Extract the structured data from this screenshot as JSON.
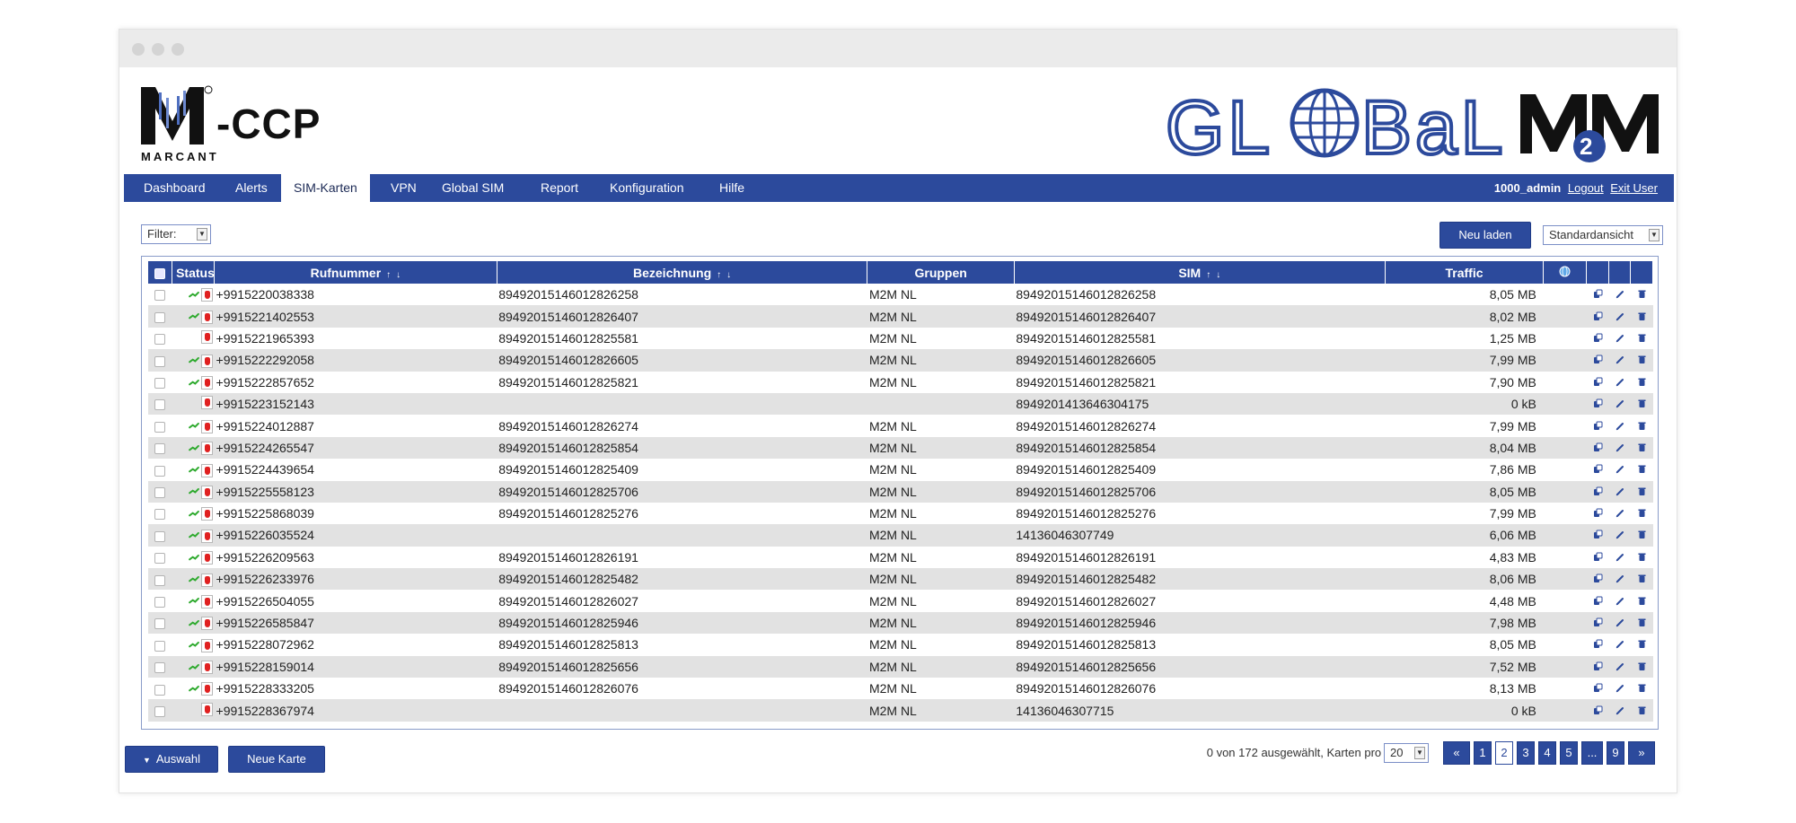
{
  "brand": {
    "left_logo_mark": "M",
    "left_logo_suffix": "-CCP",
    "left_logo_sub": "MARCANT",
    "right_logo_text": "GLOBAL",
    "right_logo_m2m": "M",
    "right_logo_two": "2",
    "accent_color": "#2c4a9c"
  },
  "nav": {
    "items": [
      {
        "label": "Dashboard"
      },
      {
        "label": "Alerts"
      },
      {
        "label": "SIM-Karten",
        "active": true
      },
      {
        "label": "VPN"
      },
      {
        "label": "Global SIM"
      },
      {
        "label": "Report"
      },
      {
        "label": "Konfiguration"
      },
      {
        "label": "Hilfe"
      }
    ],
    "user": "1000_admin",
    "logout": "Logout",
    "exit": "Exit User"
  },
  "toolbar": {
    "filter_label": "Filter:",
    "reload_label": "Neu laden",
    "view_select": "Standardansicht"
  },
  "table": {
    "headers": {
      "status": "Status",
      "rufnummer": "Rufnummer",
      "bezeichnung": "Bezeichnung",
      "gruppen": "Gruppen",
      "sim": "SIM",
      "traffic": "Traffic",
      "sort_up": "↑",
      "sort_down": "↓"
    },
    "rows": [
      {
        "active": true,
        "rufnummer": "+9915220038338",
        "bezeichnung": "89492015146012826258",
        "gruppen": "M2M NL",
        "sim": "89492015146012826258",
        "traffic": "8,05 MB"
      },
      {
        "active": true,
        "rufnummer": "+9915221402553",
        "bezeichnung": "89492015146012826407",
        "gruppen": "M2M NL",
        "sim": "89492015146012826407",
        "traffic": "8,02 MB"
      },
      {
        "active": false,
        "rufnummer": "+9915221965393",
        "bezeichnung": "89492015146012825581",
        "gruppen": "M2M NL",
        "sim": "89492015146012825581",
        "traffic": "1,25 MB"
      },
      {
        "active": true,
        "rufnummer": "+9915222292058",
        "bezeichnung": "89492015146012826605",
        "gruppen": "M2M NL",
        "sim": "89492015146012826605",
        "traffic": "7,99 MB"
      },
      {
        "active": true,
        "rufnummer": "+9915222857652",
        "bezeichnung": "89492015146012825821",
        "gruppen": "M2M NL",
        "sim": "89492015146012825821",
        "traffic": "7,90 MB"
      },
      {
        "active": false,
        "rufnummer": "+9915223152143",
        "bezeichnung": "",
        "gruppen": "",
        "sim": "8949201413646304175",
        "traffic": "0 kB"
      },
      {
        "active": true,
        "rufnummer": "+9915224012887",
        "bezeichnung": "89492015146012826274",
        "gruppen": "M2M NL",
        "sim": "89492015146012826274",
        "traffic": "7,99 MB"
      },
      {
        "active": true,
        "rufnummer": "+9915224265547",
        "bezeichnung": "89492015146012825854",
        "gruppen": "M2M NL",
        "sim": "89492015146012825854",
        "traffic": "8,04 MB"
      },
      {
        "active": true,
        "rufnummer": "+9915224439654",
        "bezeichnung": "89492015146012825409",
        "gruppen": "M2M NL",
        "sim": "89492015146012825409",
        "traffic": "7,86 MB"
      },
      {
        "active": true,
        "rufnummer": "+9915225558123",
        "bezeichnung": "89492015146012825706",
        "gruppen": "M2M NL",
        "sim": "89492015146012825706",
        "traffic": "8,05 MB"
      },
      {
        "active": true,
        "rufnummer": "+9915225868039",
        "bezeichnung": "89492015146012825276",
        "gruppen": "M2M NL",
        "sim": "89492015146012825276",
        "traffic": "7,99 MB"
      },
      {
        "active": true,
        "rufnummer": "+9915226035524",
        "bezeichnung": "",
        "gruppen": "M2M NL",
        "sim": "14136046307749",
        "traffic": "6,06 MB"
      },
      {
        "active": true,
        "rufnummer": "+9915226209563",
        "bezeichnung": "89492015146012826191",
        "gruppen": "M2M NL",
        "sim": "89492015146012826191",
        "traffic": "4,83 MB"
      },
      {
        "active": true,
        "rufnummer": "+9915226233976",
        "bezeichnung": "89492015146012825482",
        "gruppen": "M2M NL",
        "sim": "89492015146012825482",
        "traffic": "8,06 MB"
      },
      {
        "active": true,
        "rufnummer": "+9915226504055",
        "bezeichnung": "89492015146012826027",
        "gruppen": "M2M NL",
        "sim": "89492015146012826027",
        "traffic": "4,48 MB"
      },
      {
        "active": true,
        "rufnummer": "+9915226585847",
        "bezeichnung": "89492015146012825946",
        "gruppen": "M2M NL",
        "sim": "89492015146012825946",
        "traffic": "7,98 MB"
      },
      {
        "active": true,
        "rufnummer": "+9915228072962",
        "bezeichnung": "89492015146012825813",
        "gruppen": "M2M NL",
        "sim": "89492015146012825813",
        "traffic": "8,05 MB"
      },
      {
        "active": true,
        "rufnummer": "+9915228159014",
        "bezeichnung": "89492015146012825656",
        "gruppen": "M2M NL",
        "sim": "89492015146012825656",
        "traffic": "7,52 MB"
      },
      {
        "active": true,
        "rufnummer": "+9915228333205",
        "bezeichnung": "89492015146012826076",
        "gruppen": "M2M NL",
        "sim": "89492015146012826076",
        "traffic": "8,13 MB"
      },
      {
        "active": false,
        "rufnummer": "+9915228367974",
        "bezeichnung": "",
        "gruppen": "M2M NL",
        "sim": "14136046307715",
        "traffic": "0 kB"
      }
    ]
  },
  "footer": {
    "auswahl_label": "Auswahl",
    "new_card_label": "Neue Karte",
    "selection_text": "0 von 172 ausgewählt, Karten pro Seite:",
    "per_page": "20",
    "pages": {
      "first": "«",
      "p1": "1",
      "p2": "2",
      "p3": "3",
      "p4": "4",
      "p5": "5",
      "ellipsis": "...",
      "p9": "9",
      "last": "»"
    }
  }
}
